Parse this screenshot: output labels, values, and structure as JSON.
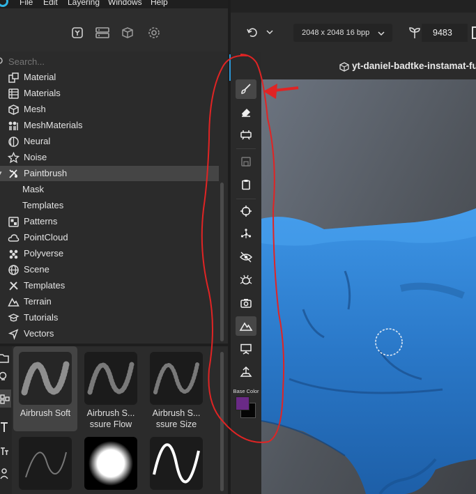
{
  "menu": [
    "File",
    "Edit",
    "Layering",
    "Windows",
    "Help"
  ],
  "left_toolbar": {
    "icons": [
      "library-icon",
      "layers-icon",
      "materials-icon",
      "settings-icon"
    ]
  },
  "search": {
    "placeholder": "Search..."
  },
  "tree": {
    "items": [
      {
        "label": "Material",
        "icon": "material-icon"
      },
      {
        "label": "Materials",
        "icon": "materials-icon"
      },
      {
        "label": "Mesh",
        "icon": "mesh-icon"
      },
      {
        "label": "MeshMaterials",
        "icon": "mesh-materials-icon"
      },
      {
        "label": "Neural",
        "icon": "neural-icon"
      },
      {
        "label": "Noise",
        "icon": "noise-icon"
      },
      {
        "label": "Paintbrush",
        "icon": "paintbrush-icon",
        "selected": true,
        "expanded": true
      },
      {
        "label": "Mask",
        "child": true
      },
      {
        "label": "Templates",
        "child": true
      },
      {
        "label": "Patterns",
        "icon": "patterns-icon"
      },
      {
        "label": "PointCloud",
        "icon": "pointcloud-icon"
      },
      {
        "label": "Polyverse",
        "icon": "polyverse-icon"
      },
      {
        "label": "Scene",
        "icon": "scene-icon"
      },
      {
        "label": "Templates",
        "icon": "templates-icon"
      },
      {
        "label": "Terrain",
        "icon": "terrain-icon"
      },
      {
        "label": "Tutorials",
        "icon": "tutorials-icon"
      },
      {
        "label": "Vectors",
        "icon": "vectors-icon"
      }
    ]
  },
  "brushes": [
    {
      "name": "Airbrush Soft",
      "selected": true
    },
    {
      "name": "Airbrush S...\nssure Flow"
    },
    {
      "name": "Airbrush S...\nssure Size"
    },
    {
      "name": ""
    },
    {
      "name": ""
    },
    {
      "name": ""
    }
  ],
  "vertical_toolbar": {
    "tools": [
      "paintbrush-icon",
      "eraser-icon",
      "projection-icon",
      "save-icon",
      "clipboard-icon",
      "crosshair-icon",
      "nodes-icon",
      "visibility-icon",
      "bug-icon",
      "camera-icon",
      "terrain-icon",
      "presentation-icon",
      "export-icon"
    ],
    "active_tools": [
      "paintbrush-icon",
      "terrain-icon"
    ],
    "base_color_label": "Base Color",
    "primary_color": "#6a2a86",
    "secondary_color": "#050505"
  },
  "top_toolbar": {
    "resolution": "2048 x 2048 16 bpp",
    "seed": "9483"
  },
  "document": {
    "title": "yt-daniel-badtke-instamat-fu"
  },
  "colors": {
    "accent": "#2a95d4",
    "annotation": "#e02424",
    "model": "#2f7fd0"
  }
}
